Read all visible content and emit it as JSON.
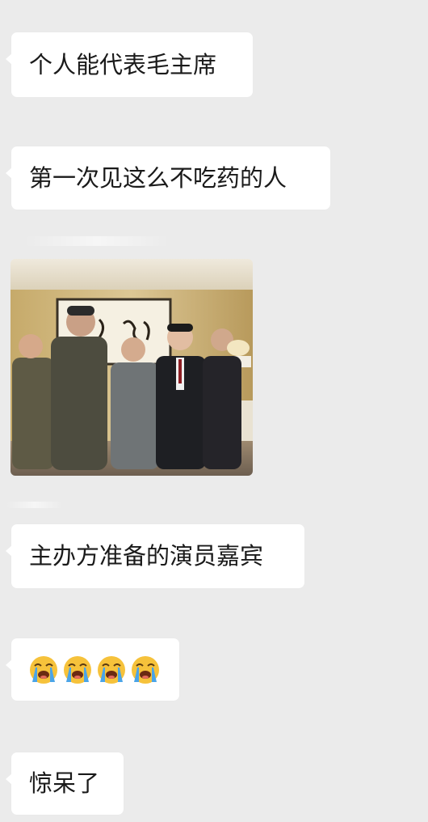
{
  "conversation": {
    "messages": [
      {
        "type": "text",
        "text": "个人能代表毛主席"
      },
      {
        "type": "text",
        "text": "第一次见这么不吃药的人"
      },
      {
        "type": "image",
        "icon": "photo-of-six-men-standing-in-room"
      },
      {
        "type": "text",
        "text": "主办方准备的演员嘉宾"
      },
      {
        "type": "emoji",
        "icon": "loudly-crying-face-emoji",
        "count": 4
      },
      {
        "type": "text",
        "text": "惊呆了"
      }
    ]
  }
}
